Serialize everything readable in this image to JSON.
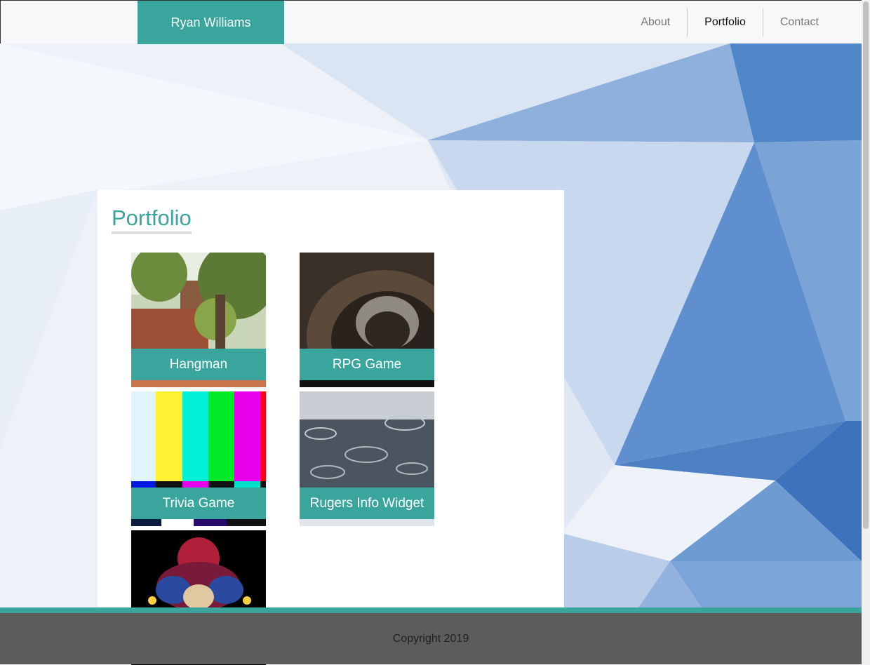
{
  "navbar": {
    "brand": "Ryan Williams",
    "links": [
      {
        "label": "About",
        "active": false
      },
      {
        "label": "Portfolio",
        "active": true
      },
      {
        "label": "Contact",
        "active": false
      }
    ]
  },
  "portfolio": {
    "title": "Portfolio",
    "items": [
      {
        "label": "Hangman"
      },
      {
        "label": "RPG Game"
      },
      {
        "label": "Trivia Game"
      },
      {
        "label": "Rugers Info Widget"
      },
      {
        "label": ""
      }
    ]
  },
  "footer": {
    "text": "Copyright 2019"
  },
  "colors": {
    "accent": "#3aa59c",
    "footer_bg": "#5c5c5c",
    "nav_bg": "#f7f8f9"
  }
}
